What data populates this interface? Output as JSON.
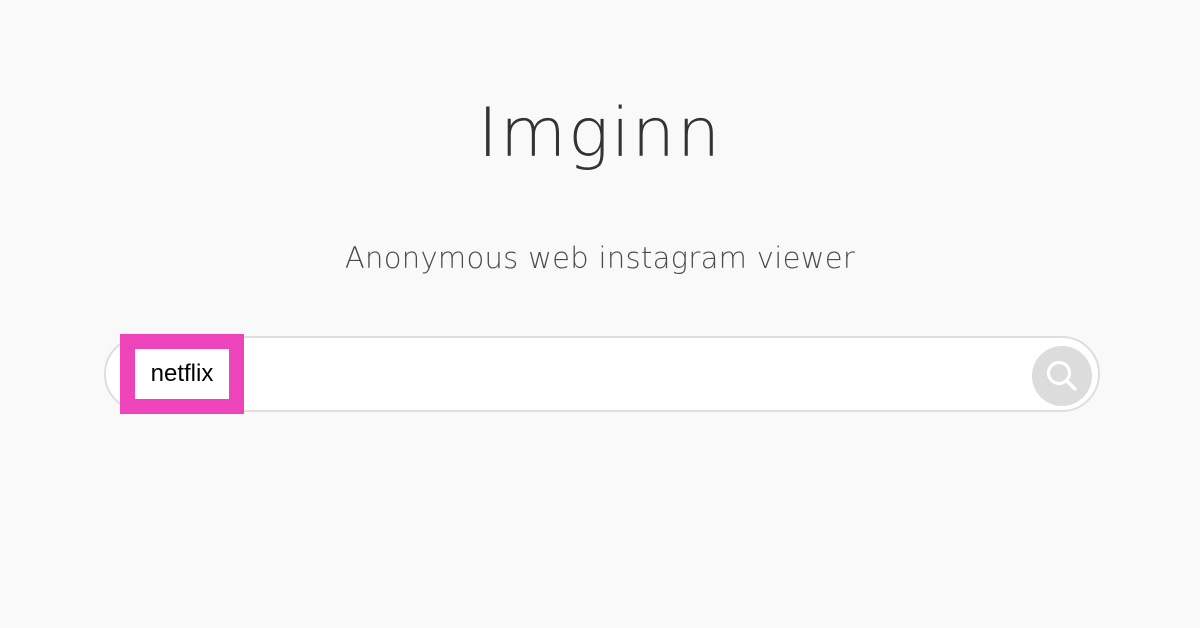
{
  "header": {
    "title": "Imginn",
    "tagline": "Anonymous web instagram viewer"
  },
  "search": {
    "value": "netflix",
    "placeholder": "",
    "button_icon": "search-icon"
  },
  "annotation": {
    "highlighted_text": "netflix",
    "color": "#ee44bb"
  },
  "colors": {
    "background": "#f9f9f9",
    "search_button": "#dcdcdc"
  }
}
